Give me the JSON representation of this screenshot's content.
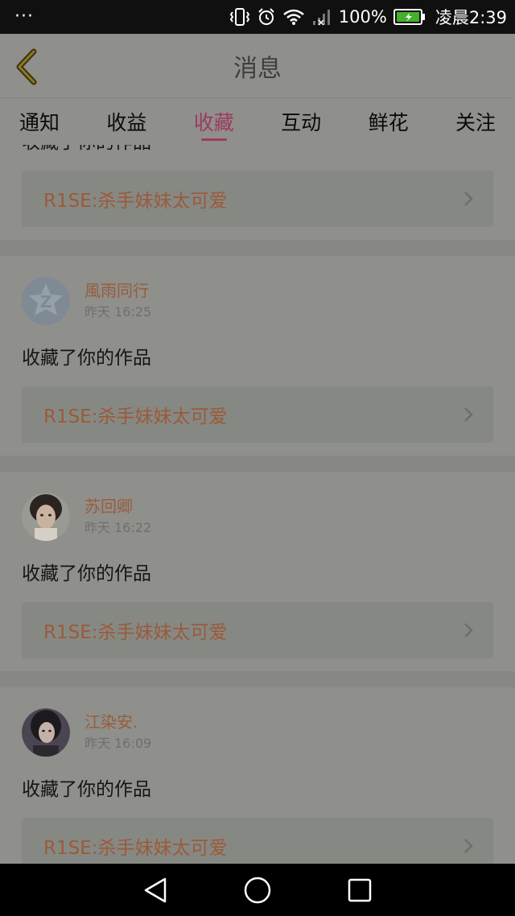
{
  "status_bar": {
    "menu": "···",
    "battery": "100%",
    "time": "凌晨2:39"
  },
  "header": {
    "title": "消息"
  },
  "tabs": [
    {
      "label": "通知",
      "active": false
    },
    {
      "label": "收益",
      "active": false
    },
    {
      "label": "收藏",
      "active": true
    },
    {
      "label": "互动",
      "active": false
    },
    {
      "label": "鲜花",
      "active": false
    },
    {
      "label": "关注",
      "active": false
    }
  ],
  "feed": [
    {
      "partial": true,
      "action": "收藏了你的作品",
      "work_title": "R1SE:杀手妹妹太可爱"
    },
    {
      "username": "風雨同行",
      "time": "昨天 16:25",
      "action": "收藏了你的作品",
      "work_title": "R1SE:杀手妹妹太可爱",
      "avatar": "default-qzone-avatar"
    },
    {
      "username": "苏回卿",
      "time": "昨天 16:22",
      "action": "收藏了你的作品",
      "work_title": "R1SE:杀手妹妹太可爱",
      "avatar": "photo-avatar-girl"
    },
    {
      "username": "江染安.",
      "time": "昨天 16:09",
      "action": "收藏了你的作品",
      "work_title": "R1SE:杀手妹妹太可爱",
      "avatar": "photo-avatar-woman"
    }
  ],
  "colors": {
    "overlay_bg": "#8f8f8b",
    "active_tab": "#9c3b60",
    "username": "#985d3b",
    "work_title": "#9b5a3a"
  }
}
